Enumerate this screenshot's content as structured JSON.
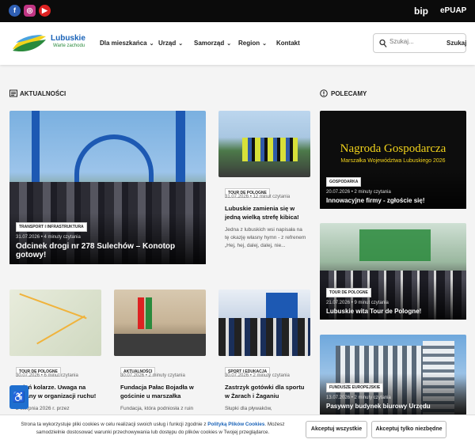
{
  "topbar": {
    "social": [
      "facebook-icon",
      "instagram-icon",
      "youtube-icon"
    ],
    "bip": "bip",
    "epuap": "ePUAP"
  },
  "header": {
    "logo_name": "Lubuskie",
    "logo_sub": "Warte zachodu",
    "nav": [
      "Dla mieszkańca",
      "Urząd",
      "Samorząd",
      "Region",
      "Kontakt"
    ],
    "search_placeholder": "Szukaj...",
    "search_button": "Szukaj"
  },
  "sections": {
    "news": "AKTUALNOŚCI",
    "recommended": "POLECAMY"
  },
  "featured": {
    "tag": "TRANSPORT I INFRASTRUKTURA",
    "date": "31.07.2026",
    "read": "4 minuty czytania",
    "title": "Odcinek drogi nr 278 Sulechów – Konotop gotowy!"
  },
  "side_article": {
    "tag": "TOUR DE POLOGNE",
    "date": "31.07.2026",
    "read": "12 minut czytania",
    "title": "Lubuskie zamienia się w jedną wielką strefę kibica!",
    "excerpt": "Jedna z lubuskich wsi napisała na tę okazję własny hymn - z refrenem „Hej, hej, dalej, dalej, nie..."
  },
  "bottom_articles": [
    {
      "tag": "TOUR DE POLOGNE",
      "date": "30.07.2026",
      "read": "6 minut czytania",
      "title": "Dzień kolarze. Uwaga na zmiany w organizacji ruchu!",
      "excerpt": "2 sierpnia 2026 r. przez"
    },
    {
      "tag": "AKTUALNOŚCI",
      "date": "30.07.2026",
      "read": "2 minuty czytania",
      "title": "Fundacja Pałac Bojadła w gościnie u marszałka",
      "excerpt": "Fundacja, która podniosła z ruin"
    },
    {
      "tag": "SPORT I EDUKACJA",
      "date": "30.07.2026",
      "read": "2 minuty czytania",
      "title": "Zastrzyk gotówki dla sportu w Żarach i Żaganiu",
      "excerpt": "Słupki dla pływaków,"
    }
  ],
  "recommended": [
    {
      "banner_line1": "Nagroda Gospodarcza",
      "banner_line2": "Marszałka Województwa Lubuskiego 2026",
      "tag": "GOSPODARKA",
      "date": "20.07.2026",
      "read": "2 minuty czytania",
      "title": "Innowacyjne firmy - zgłoście się!"
    },
    {
      "tag": "TOUR DE POLOGNE",
      "date": "21.07.2026",
      "read": "9 minut czytania",
      "title": "Lubuskie wita Tour de Pologne!"
    },
    {
      "tag": "FUNDUSZE EUROPEJSKIE",
      "date": "13.07.2026",
      "read": "2 minuty czytania",
      "title": "Pasywny budynek biurowy Urzędu"
    }
  ],
  "cookie": {
    "text_before": "Strona ta wykorzystuje pliki cookies w celu realizacji swoich usług i funkcji zgodnie z ",
    "link": "Polityką Plików Cookies",
    "text_after": ". Możesz samodzielnie dostosować warunki przechowywania lub dostępu do plików cookies w Twojej przeglądarce.",
    "accept_all": "Akceptuj wszystkie",
    "accept_necessary": "Akceptuj tylko niezbędne"
  },
  "colors": {
    "brand_blue": "#1a63b8",
    "brand_green": "#2a8a3c",
    "accent_yellow": "#f2d31b"
  }
}
